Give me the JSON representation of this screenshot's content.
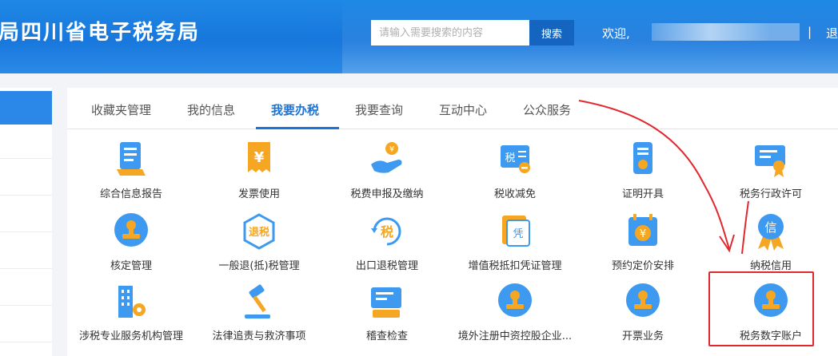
{
  "header": {
    "title": "局四川省电子税务局",
    "search_placeholder": "请输入需要搜索的内容",
    "search_button": "搜索",
    "welcome": "欢迎,",
    "separator": "|",
    "logout": "退"
  },
  "tabs": [
    {
      "label": "收藏夹管理",
      "active": false
    },
    {
      "label": "我的信息",
      "active": false
    },
    {
      "label": "我要办税",
      "active": true
    },
    {
      "label": "我要查询",
      "active": false
    },
    {
      "label": "互动中心",
      "active": false
    },
    {
      "label": "公众服务",
      "active": false
    }
  ],
  "items": [
    {
      "label": "综合信息报告",
      "icon": "document-report-icon"
    },
    {
      "label": "发票使用",
      "icon": "invoice-yen-icon"
    },
    {
      "label": "税费申报及缴纳",
      "icon": "hand-coin-icon"
    },
    {
      "label": "税收减免",
      "icon": "tax-reduction-icon"
    },
    {
      "label": "证明开具",
      "icon": "certificate-icon"
    },
    {
      "label": "税务行政许可",
      "icon": "license-ribbon-icon"
    },
    {
      "label": "核定管理",
      "icon": "stamp-icon"
    },
    {
      "label": "一般退(抵)税管理",
      "icon": "refund-hexagon-icon"
    },
    {
      "label": "出口退税管理",
      "icon": "export-refund-icon"
    },
    {
      "label": "增值税抵扣凭证管理",
      "icon": "voucher-icon"
    },
    {
      "label": "预约定价安排",
      "icon": "calendar-yen-icon"
    },
    {
      "label": "纳税信用",
      "icon": "credit-badge-icon"
    },
    {
      "label": "涉税专业服务机构管理",
      "icon": "building-gear-icon"
    },
    {
      "label": "法律追责与救济事项",
      "icon": "gavel-icon"
    },
    {
      "label": "稽查检查",
      "icon": "inspection-icon"
    },
    {
      "label": "境外注册中资控股企业...",
      "icon": "stamp-icon"
    },
    {
      "label": "开票业务",
      "icon": "stamp-icon"
    },
    {
      "label": "税务数字账户",
      "icon": "stamp-icon"
    }
  ],
  "colors": {
    "header_blue": "#1e88e5",
    "accent_blue": "#1a73d9",
    "icon_blue": "#3d9af0",
    "icon_orange": "#f5a623",
    "annotation_red": "#e0282e"
  }
}
